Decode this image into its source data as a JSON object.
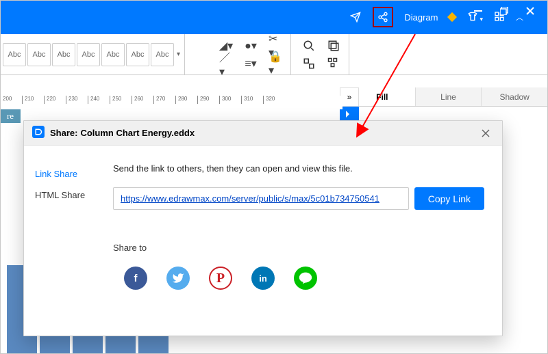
{
  "titlebar": {
    "diagram_label": "Diagram"
  },
  "toolbar": {
    "abc": "Abc"
  },
  "right_panel": {
    "tabs": [
      {
        "label": "Fill",
        "active": true
      },
      {
        "label": "Line",
        "active": false
      },
      {
        "label": "Shadow",
        "active": false
      }
    ]
  },
  "ruler": [
    "200",
    "210",
    "220",
    "230",
    "240",
    "250",
    "260",
    "270",
    "280",
    "290",
    "300",
    "310",
    "320"
  ],
  "partial_text": "re",
  "modal": {
    "title_prefix": "Share:",
    "filename": "Column Chart Energy.eddx",
    "tabs": [
      {
        "label": "Link Share",
        "key": "link",
        "active": true
      },
      {
        "label": "HTML Share",
        "key": "html",
        "active": false
      }
    ],
    "desc": "Send the link to others, then they can open and view this file.",
    "link_url": "https://www.edrawmax.com/server/public/s/max/5c01b734750541",
    "copy_btn": "Copy Link",
    "share_to_label": "Share to",
    "social": [
      {
        "name": "facebook",
        "glyph": "f",
        "class": "fb"
      },
      {
        "name": "twitter",
        "glyph": "",
        "class": "tw"
      },
      {
        "name": "pinterest",
        "glyph": "P",
        "class": "pt"
      },
      {
        "name": "linkedin",
        "glyph": "in",
        "class": "li"
      },
      {
        "name": "line",
        "glyph": "",
        "class": "ln"
      }
    ]
  },
  "colors": {
    "primary": "#0079ff",
    "arrow": "#ff0000",
    "highlight_border": "#9d0000"
  }
}
